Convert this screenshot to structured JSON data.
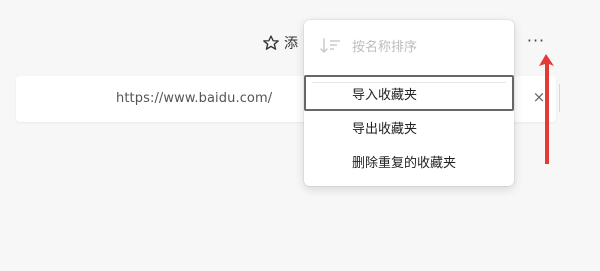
{
  "toolbar": {
    "favorite_icon": "star-icon",
    "add_label_partial": "添",
    "more_label": "···"
  },
  "url_row": {
    "url": "https://www.baidu.com/",
    "close_label": "×"
  },
  "menu": {
    "sort_icon": "sort-icon",
    "items": [
      {
        "label": "按名称排序",
        "state": "disabled"
      },
      {
        "label": "导入收藏夹",
        "state": "focused"
      },
      {
        "label": "导出收藏夹",
        "state": "normal"
      },
      {
        "label": "删除重复的收藏夹",
        "state": "normal"
      }
    ]
  },
  "annotation": {
    "color": "#e53935"
  }
}
